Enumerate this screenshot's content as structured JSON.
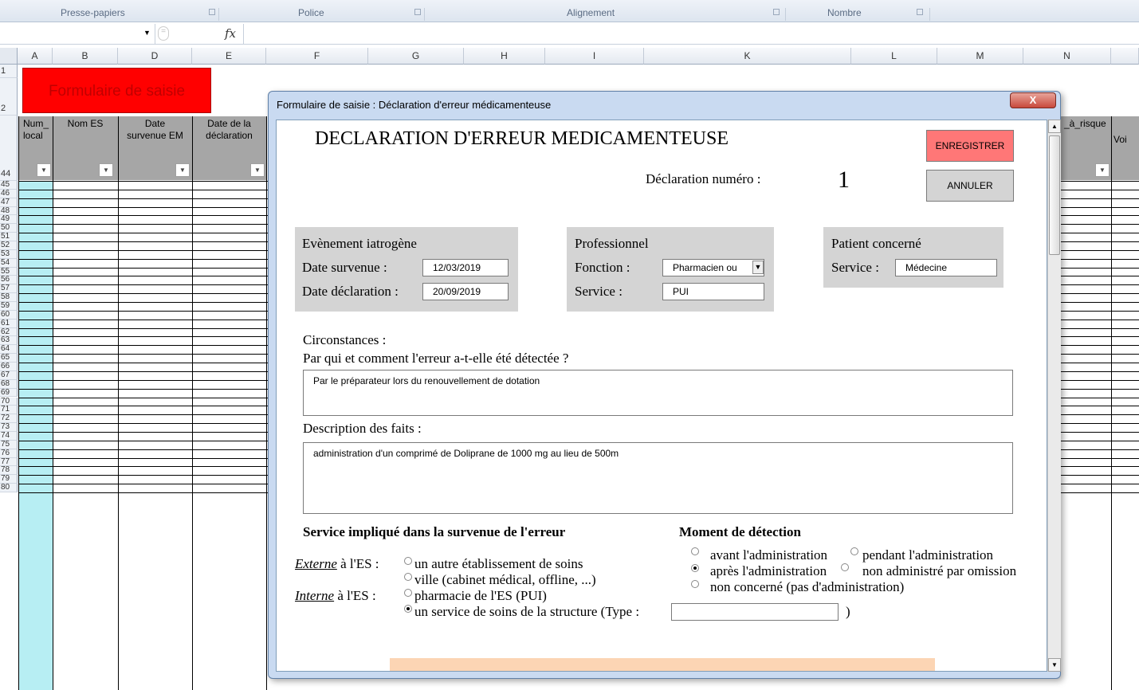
{
  "ribbon": {
    "groups": [
      "Presse-papiers",
      "Police",
      "Alignement",
      "Nombre"
    ]
  },
  "formula_bar": {
    "fx": "fx"
  },
  "columns": [
    "A",
    "B",
    "D",
    "E",
    "F",
    "G",
    "H",
    "I",
    "K",
    "L",
    "M",
    "N"
  ],
  "rows": [
    "1",
    "2",
    "44",
    "45",
    "46",
    "47",
    "48",
    "49",
    "50",
    "51",
    "52",
    "53",
    "54",
    "55",
    "56",
    "57",
    "58",
    "59",
    "60",
    "61",
    "62",
    "63",
    "64",
    "65",
    "66",
    "67",
    "68",
    "69",
    "70",
    "71",
    "72",
    "73",
    "74",
    "75",
    "76",
    "77",
    "78",
    "79",
    "80"
  ],
  "sheet": {
    "title_cell": "Formulaire de saisie",
    "headers": [
      {
        "line1": "Num_",
        "line2": "local"
      },
      {
        "line1": "Nom ES",
        "line2": ""
      },
      {
        "line1": "Date",
        "line2": "survenue EM"
      },
      {
        "line1": "Date de la",
        "line2": "déclaration"
      },
      {
        "line1": "_à_risque",
        "line2": ""
      },
      {
        "line1": "",
        "line2": "Voi"
      }
    ]
  },
  "dialog": {
    "title": "Formulaire de saisie : Déclaration d'erreur médicamenteuse",
    "close": "X",
    "heading": "DECLARATION D'ERREUR MEDICAMENTEUSE",
    "save_button": "ENREGISTRER",
    "cancel_button": "ANNULER",
    "number_label": "Déclaration numéro :",
    "number_value": "1",
    "event": {
      "title": "Evènement iatrogène",
      "date_label": "Date survenue :",
      "date_value": "12/03/2019",
      "decl_label": "Date déclaration :",
      "decl_value": "20/09/2019"
    },
    "professional": {
      "title": "Professionnel",
      "function_label": "Fonction :",
      "function_value": "Pharmacien ou",
      "service_label": "Service :",
      "service_value": "PUI"
    },
    "patient": {
      "title": "Patient concerné",
      "service_label": "Service :",
      "service_value": "Médecine"
    },
    "circumstances_label": "Circonstances :",
    "detect_question": "Par qui et comment l'erreur a-t-elle été détectée ?",
    "detect_answer": "Par le préparateur lors du renouvellement de dotation",
    "description_label": "Description des faits :",
    "description_answer": "administration d'un comprimé de Doliprane de 1000 mg au lieu de 500m",
    "service_section": {
      "title": "Service impliqué dans la survenue de l'erreur",
      "externe": "Externe",
      "externe_suffix": " à l'ES :",
      "interne": "Interne",
      "interne_suffix": " à l'ES :",
      "options": [
        "un autre établissement de soins",
        "ville (cabinet médical, offline, ...)",
        "pharmacie de l'ES (PUI)",
        "un service de soins de la structure (Type :"
      ],
      "close_paren": ")"
    },
    "moment_section": {
      "title": "Moment de détection",
      "options": [
        "avant l'administration",
        "pendant l'administration",
        "après l'administration",
        "non administré par omission",
        "non concerné (pas d'administration)"
      ]
    }
  }
}
